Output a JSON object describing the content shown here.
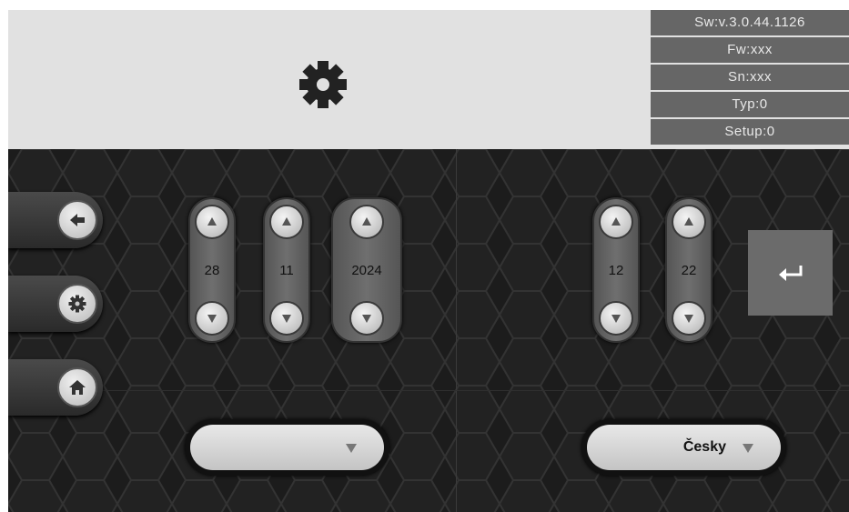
{
  "info": {
    "sw": "Sw:v.3.0.44.1126",
    "fw": "Fw:xxx",
    "sn": "Sn:xxx",
    "typ": "Typ:0",
    "setup": "Setup:0"
  },
  "date": {
    "day": "28",
    "month": "11",
    "year": "2024"
  },
  "time": {
    "hour": "12",
    "minute": "22"
  },
  "dropdowns": {
    "left_value": "",
    "language_value": "Česky"
  },
  "icons": {
    "title": "gear-icon",
    "back": "arrow-left-icon",
    "settings": "gear-icon",
    "home": "home-icon",
    "up": "triangle-up-icon",
    "down": "triangle-down-icon",
    "enter": "enter-return-icon",
    "dropdown_arrow": "triangle-down-icon"
  },
  "colors": {
    "header_bg": "#e1e1e1",
    "info_bg": "#666666",
    "main_bg": "#1a1a1a",
    "accent_button": "#6b6b6b"
  }
}
